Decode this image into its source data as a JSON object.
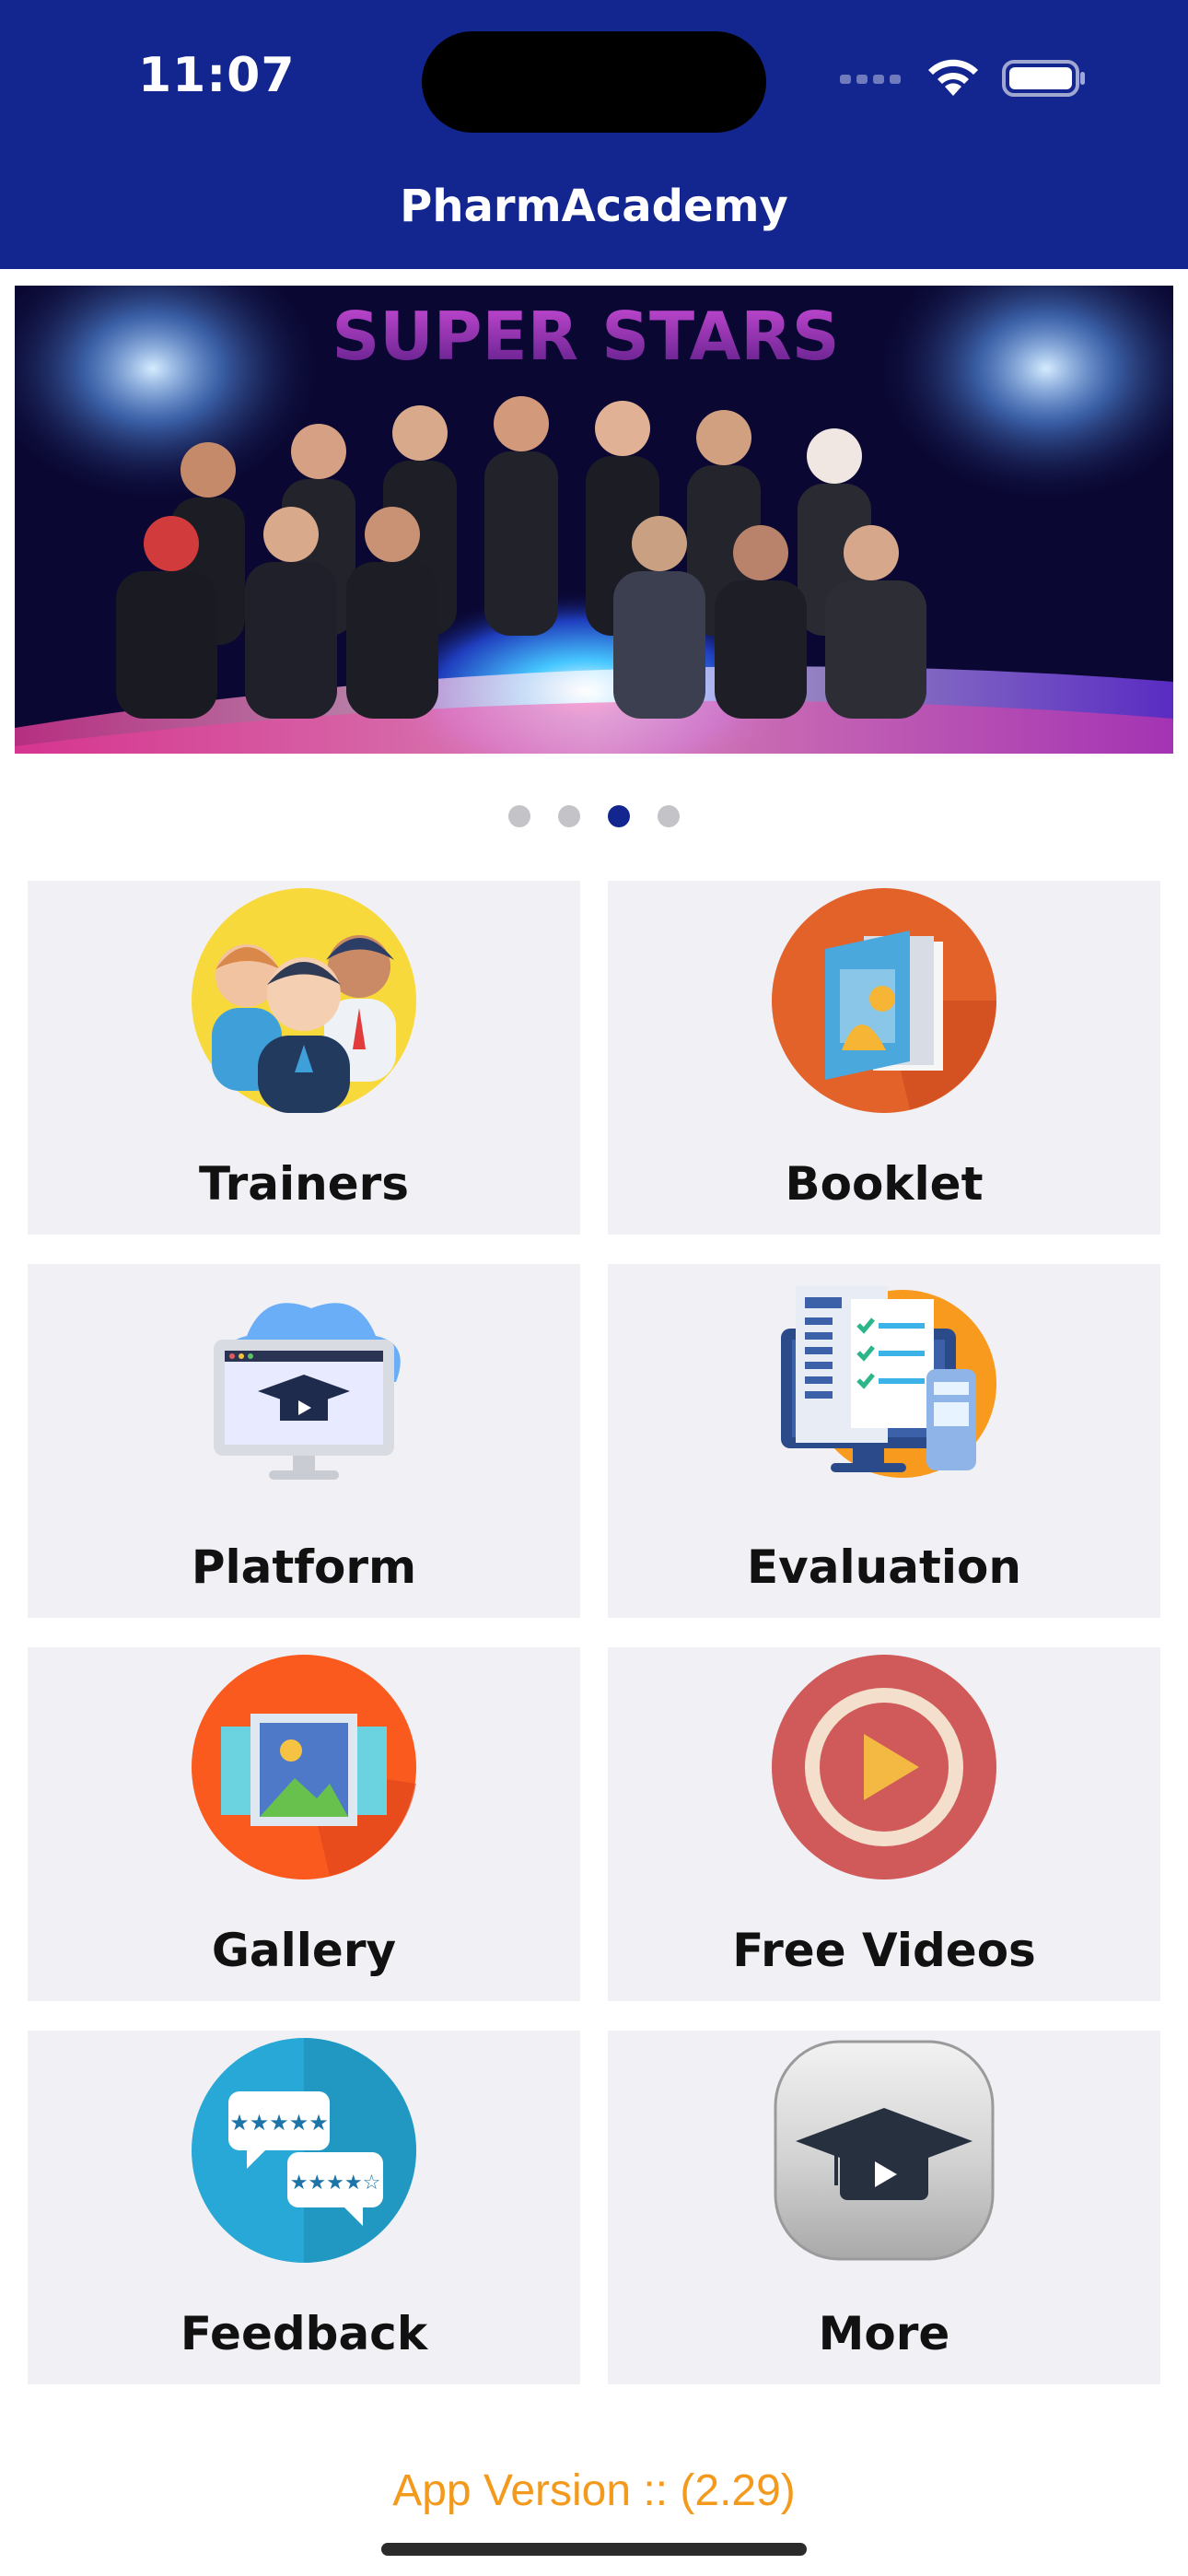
{
  "status_bar": {
    "time": "11:07"
  },
  "header": {
    "title": "PharmAcademy"
  },
  "banner": {
    "headline": "SUPER STARS",
    "carousel_dots": 4,
    "active_dot": 3
  },
  "tiles": [
    {
      "label": "Trainers",
      "icon": "trainers-icon"
    },
    {
      "label": "Booklet",
      "icon": "booklet-icon"
    },
    {
      "label": "Platform",
      "icon": "platform-icon"
    },
    {
      "label": "Evaluation",
      "icon": "evaluation-icon"
    },
    {
      "label": "Gallery",
      "icon": "gallery-icon"
    },
    {
      "label": "Free Videos",
      "icon": "free-videos-icon"
    },
    {
      "label": "Feedback",
      "icon": "feedback-icon"
    },
    {
      "label": "More",
      "icon": "more-icon"
    }
  ],
  "footer": {
    "version": "App Version :: (2.29)"
  },
  "colors": {
    "header_bg": "#13268f",
    "tile_bg": "#f1f1f5",
    "version_text": "#f39a1d"
  }
}
